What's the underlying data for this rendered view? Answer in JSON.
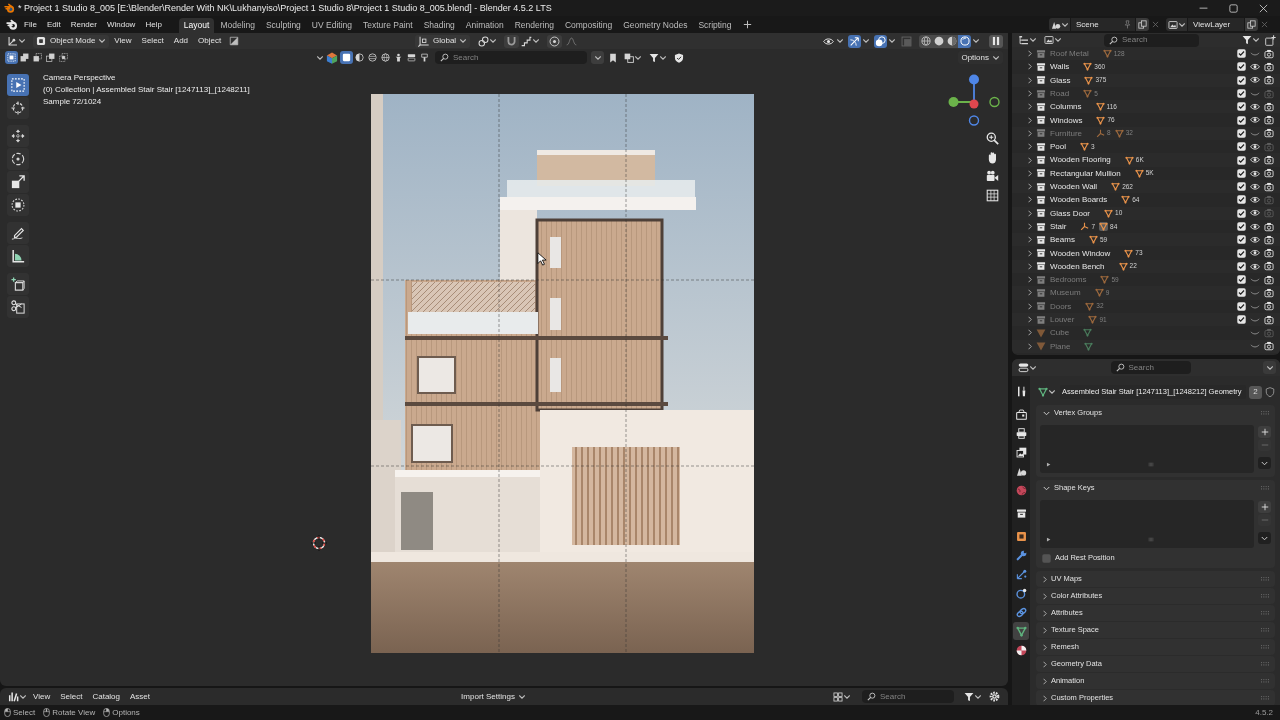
{
  "window": {
    "title": "* Project 1 Studio 8_005 [E:\\Blender\\Render With NK\\Lukhanyiso\\Project 1 Studio 8\\Project 1 Studio 8_005.blend] - Blender 4.5.2 LTS"
  },
  "menu": [
    "File",
    "Edit",
    "Render",
    "Window",
    "Help"
  ],
  "workspaces": [
    {
      "label": "Layout",
      "selected": true
    },
    {
      "label": "Modeling",
      "selected": false
    },
    {
      "label": "Sculpting",
      "selected": false
    },
    {
      "label": "UV Editing",
      "selected": false
    },
    {
      "label": "Texture Paint",
      "selected": false
    },
    {
      "label": "Shading",
      "selected": false
    },
    {
      "label": "Animation",
      "selected": false
    },
    {
      "label": "Rendering",
      "selected": false
    },
    {
      "label": "Compositing",
      "selected": false
    },
    {
      "label": "Geometry Nodes",
      "selected": false
    },
    {
      "label": "Scripting",
      "selected": false
    }
  ],
  "scene": {
    "name": "Scene"
  },
  "view_layer": {
    "name": "ViewLayer"
  },
  "viewport": {
    "mode": "Object Mode",
    "menu": [
      "View",
      "Select",
      "Add",
      "Object"
    ],
    "orientation": "Global",
    "toggles": [
      {
        "kind": "visibility",
        "on": false
      },
      {
        "kind": "gizmo",
        "on": true
      },
      {
        "kind": "overlay",
        "on": true
      },
      {
        "kind": "xray",
        "on": false
      }
    ],
    "shading": [
      {
        "kind": "wireframe",
        "selected": false
      },
      {
        "kind": "solid",
        "selected": false
      },
      {
        "kind": "material",
        "selected": false
      },
      {
        "kind": "rendered",
        "selected": true
      }
    ],
    "select_modes": [
      {
        "kind": "set",
        "selected": true
      },
      {
        "kind": "extend",
        "selected": false
      },
      {
        "kind": "subtract",
        "selected": false
      },
      {
        "kind": "invert",
        "selected": false
      },
      {
        "kind": "intersect",
        "selected": false
      }
    ],
    "filters": [
      {
        "kind": "square",
        "selected": true
      },
      {
        "kind": "half_circle",
        "selected": false
      },
      {
        "kind": "sphere",
        "selected": false
      },
      {
        "kind": "globe",
        "selected": false
      },
      {
        "kind": "figure",
        "selected": false
      },
      {
        "kind": "stack",
        "selected": false
      },
      {
        "kind": "brush",
        "selected": false
      }
    ],
    "search": {
      "placeholder": "Search"
    },
    "options": "Options",
    "info": [
      "Camera Perspective",
      "(0) Collection | Assembled Stair Stair [1247113]_[1248211]",
      "Sample 72/1024"
    ],
    "tool_groups": [
      [
        {
          "kind": "select_box",
          "selected": true
        },
        {
          "kind": "cursor",
          "selected": false
        }
      ],
      [
        {
          "kind": "move",
          "selected": false
        },
        {
          "kind": "rotate",
          "selected": false
        },
        {
          "kind": "scale",
          "selected": false
        },
        {
          "kind": "transform",
          "selected": false
        }
      ],
      [
        {
          "kind": "annotate",
          "selected": false
        },
        {
          "kind": "measure",
          "selected": false
        }
      ],
      [
        {
          "kind": "add_cube",
          "selected": false
        },
        {
          "kind": "cut",
          "selected": false
        }
      ]
    ]
  },
  "outliner": {
    "search": {
      "placeholder": "Search"
    },
    "rows": [
      {
        "name": "Roof Metal",
        "kind": "collection",
        "checked": true,
        "visible": false,
        "renderable": true,
        "data": [
          {
            "kind": "mesh",
            "count": "128",
            "selected": false
          }
        ]
      },
      {
        "name": "Walls",
        "kind": "collection",
        "checked": true,
        "visible": true,
        "renderable": true,
        "data": [
          {
            "kind": "mesh",
            "count": "360",
            "selected": false
          }
        ]
      },
      {
        "name": "Glass",
        "kind": "collection",
        "checked": true,
        "visible": true,
        "renderable": true,
        "data": [
          {
            "kind": "mesh",
            "count": "375",
            "selected": false
          }
        ]
      },
      {
        "name": "Road",
        "kind": "collection",
        "checked": true,
        "visible": false,
        "renderable": false,
        "data": [
          {
            "kind": "mesh",
            "count": "5",
            "selected": false
          }
        ]
      },
      {
        "name": "Columns",
        "kind": "collection",
        "checked": true,
        "visible": true,
        "renderable": true,
        "data": [
          {
            "kind": "mesh",
            "count": "116",
            "selected": false
          }
        ]
      },
      {
        "name": "Windows",
        "kind": "collection",
        "checked": true,
        "visible": true,
        "renderable": true,
        "data": [
          {
            "kind": "mesh",
            "count": "76",
            "selected": false
          }
        ]
      },
      {
        "name": "Furniture",
        "kind": "collection",
        "checked": true,
        "visible": false,
        "renderable": true,
        "data": [
          {
            "kind": "empty",
            "count": "8",
            "selected": false
          },
          {
            "kind": "mesh",
            "count": "32",
            "selected": false
          }
        ]
      },
      {
        "name": "Pool",
        "kind": "collection",
        "checked": true,
        "visible": true,
        "renderable": false,
        "data": [
          {
            "kind": "mesh",
            "count": "3",
            "selected": false
          }
        ]
      },
      {
        "name": "Wooden Flooring",
        "kind": "collection",
        "checked": true,
        "visible": true,
        "renderable": true,
        "data": [
          {
            "kind": "mesh",
            "count": "6K",
            "selected": false
          }
        ]
      },
      {
        "name": "Rectangular Mullion",
        "kind": "collection",
        "checked": true,
        "visible": true,
        "renderable": true,
        "data": [
          {
            "kind": "mesh",
            "count": "5K",
            "selected": false
          }
        ]
      },
      {
        "name": "Wooden Wall",
        "kind": "collection",
        "checked": true,
        "visible": true,
        "renderable": true,
        "data": [
          {
            "kind": "mesh",
            "count": "262",
            "selected": false
          }
        ]
      },
      {
        "name": "Wooden Boards",
        "kind": "collection",
        "checked": true,
        "visible": true,
        "renderable": false,
        "data": [
          {
            "kind": "mesh",
            "count": "64",
            "selected": false
          }
        ]
      },
      {
        "name": "Glass Door",
        "kind": "collection",
        "checked": true,
        "visible": true,
        "renderable": false,
        "data": [
          {
            "kind": "mesh",
            "count": "10",
            "selected": false
          }
        ]
      },
      {
        "name": "Stair",
        "kind": "collection",
        "checked": true,
        "visible": true,
        "renderable": true,
        "data": [
          {
            "kind": "empty",
            "count": "7",
            "selected": false
          },
          {
            "kind": "mesh",
            "count": "84",
            "selected": true
          }
        ]
      },
      {
        "name": "Beams",
        "kind": "collection",
        "checked": true,
        "visible": true,
        "renderable": true,
        "data": [
          {
            "kind": "mesh",
            "count": "59",
            "selected": false
          }
        ]
      },
      {
        "name": "Wooden Window",
        "kind": "collection",
        "checked": true,
        "visible": true,
        "renderable": true,
        "data": [
          {
            "kind": "mesh",
            "count": "73",
            "selected": false
          }
        ]
      },
      {
        "name": "Wooden Bench",
        "kind": "collection",
        "checked": true,
        "visible": true,
        "renderable": true,
        "data": [
          {
            "kind": "mesh",
            "count": "22",
            "selected": false
          }
        ]
      },
      {
        "name": "Bedrooms",
        "kind": "collection",
        "checked": true,
        "visible": false,
        "renderable": true,
        "data": [
          {
            "kind": "mesh",
            "count": "59",
            "selected": false
          }
        ]
      },
      {
        "name": "Museum",
        "kind": "collection",
        "checked": true,
        "visible": false,
        "renderable": true,
        "data": [
          {
            "kind": "mesh",
            "count": "9",
            "selected": false
          }
        ]
      },
      {
        "name": "Doors",
        "kind": "collection",
        "checked": true,
        "visible": false,
        "renderable": true,
        "data": [
          {
            "kind": "mesh",
            "count": "32",
            "selected": false
          }
        ]
      },
      {
        "name": "Louver",
        "kind": "collection",
        "checked": true,
        "visible": false,
        "renderable": true,
        "data": [
          {
            "kind": "mesh",
            "count": "91",
            "selected": false
          }
        ]
      },
      {
        "name": "Cube",
        "kind": "object",
        "visible": false,
        "renderable": false,
        "data": [
          {
            "kind": "geometry",
            "selected": false
          }
        ]
      },
      {
        "name": "Plane",
        "kind": "object",
        "visible": false,
        "renderable": true,
        "data": [
          {
            "kind": "geometry",
            "selected": false
          }
        ]
      }
    ]
  },
  "properties": {
    "search": {
      "placeholder": "Search"
    },
    "tab_groups": [
      [
        {
          "kind": "tool",
          "selected": false
        }
      ],
      [
        {
          "kind": "render",
          "selected": false
        },
        {
          "kind": "output",
          "selected": false
        },
        {
          "kind": "view_layer",
          "selected": false
        },
        {
          "kind": "scene",
          "selected": false
        },
        {
          "kind": "world",
          "selected": false
        }
      ],
      [
        {
          "kind": "collection",
          "selected": false
        }
      ],
      [
        {
          "kind": "object",
          "selected": false
        },
        {
          "kind": "modifiers",
          "selected": false
        },
        {
          "kind": "particles",
          "selected": false
        },
        {
          "kind": "physics",
          "selected": false
        },
        {
          "kind": "constraints",
          "selected": false
        },
        {
          "kind": "data",
          "selected": true
        },
        {
          "kind": "material",
          "selected": false
        }
      ]
    ],
    "datablock": {
      "name": "Assembled Stair Stair [1247113]_[1248212] Geometry",
      "users": "2"
    },
    "panels": [
      {
        "title": "Vertex Groups",
        "expanded": true
      },
      {
        "title": "Shape Keys",
        "expanded": true,
        "option": {
          "label": "Add Rest Position",
          "checked": false
        }
      },
      {
        "title": "UV Maps",
        "expanded": false
      },
      {
        "title": "Color Attributes",
        "expanded": false
      },
      {
        "title": "Attributes",
        "expanded": false
      },
      {
        "title": "Texture Space",
        "expanded": false
      },
      {
        "title": "Remesh",
        "expanded": false
      },
      {
        "title": "Geometry Data",
        "expanded": false
      },
      {
        "title": "Animation",
        "expanded": false
      },
      {
        "title": "Custom Properties",
        "expanded": false
      }
    ]
  },
  "asset_browser": {
    "menu": [
      "View",
      "Select",
      "Catalog",
      "Asset"
    ],
    "import_settings": "Import Settings",
    "search": {
      "placeholder": "Search"
    }
  },
  "status_bar": {
    "hints": [
      {
        "kind": "left",
        "label": "Select"
      },
      {
        "kind": "middle",
        "label": "Rotate View"
      },
      {
        "kind": "right",
        "label": "Options"
      }
    ],
    "version": "4.5.2"
  }
}
